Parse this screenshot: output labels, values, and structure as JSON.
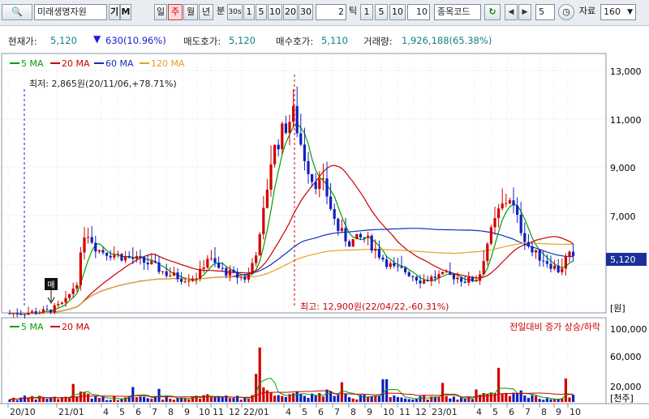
{
  "toolbar": {
    "search_label": "Q권",
    "stock_name": "미래생명자원",
    "gi_label": "기",
    "m_label": "M",
    "period_day": "일",
    "period_week": "주",
    "period_month": "월",
    "period_year": "년",
    "minute_label": "분",
    "minute_sel": "30s",
    "min_1": "1",
    "min_5": "5",
    "min_10": "10",
    "min_20": "20",
    "min_30": "30",
    "tick_value": "2",
    "tick_label": "틱",
    "tick_1": "1",
    "tick_5": "5",
    "tick_10": "10",
    "tick_input": "10",
    "code_label": "종목코드",
    "nav_count": "5",
    "data_label": "자료",
    "data_count": "160"
  },
  "info": {
    "price_label": "현재가:",
    "price_value": "5,120",
    "change_value": "630(10.96%)",
    "ask_label": "매도호가:",
    "ask_value": "5,120",
    "bid_label": "매수호가:",
    "bid_value": "5,110",
    "volume_label": "거래량:",
    "volume_value": "1,926,188(65.38%)"
  },
  "colors": {
    "up": "#d00000",
    "down": "#1020c0",
    "ma5": "#00a000",
    "ma20": "#cc0000",
    "ma60": "#1030c0",
    "ma120": "#e8a020"
  },
  "chart_data": {
    "type": "candlestick",
    "legend_price": [
      "5 MA",
      "20 MA",
      "60 MA",
      "120 MA"
    ],
    "legend_volume": [
      "5 MA",
      "20 MA"
    ],
    "price_axis_ticks": [
      "13,000",
      "11,000",
      "9,000",
      "7,000",
      "5,120"
    ],
    "price_unit": "[원]",
    "volume_axis_ticks": [
      "100,000",
      "60,000",
      "20,000"
    ],
    "volume_unit": "[천주]",
    "volume_title": "전일대비 증가 상승/하락",
    "low_annotation": "최저: 2,865원(20/11/06,+78.71%)",
    "high_annotation": "최고: 12,900원(22/04/22,-60.31%)",
    "buy_marker": "매",
    "x_labels": [
      "20/10",
      "21/01",
      "4",
      "5",
      "6",
      "7",
      "8",
      "9",
      "10",
      "11",
      "12",
      "22/01",
      "4",
      "5",
      "6",
      "7",
      "8",
      "9",
      "10",
      "11",
      "12",
      "23/01",
      "4",
      "5",
      "6",
      "7",
      "8",
      "9",
      "10"
    ],
    "current_price": 5120,
    "ylim": [
      2700,
      13600
    ]
  }
}
